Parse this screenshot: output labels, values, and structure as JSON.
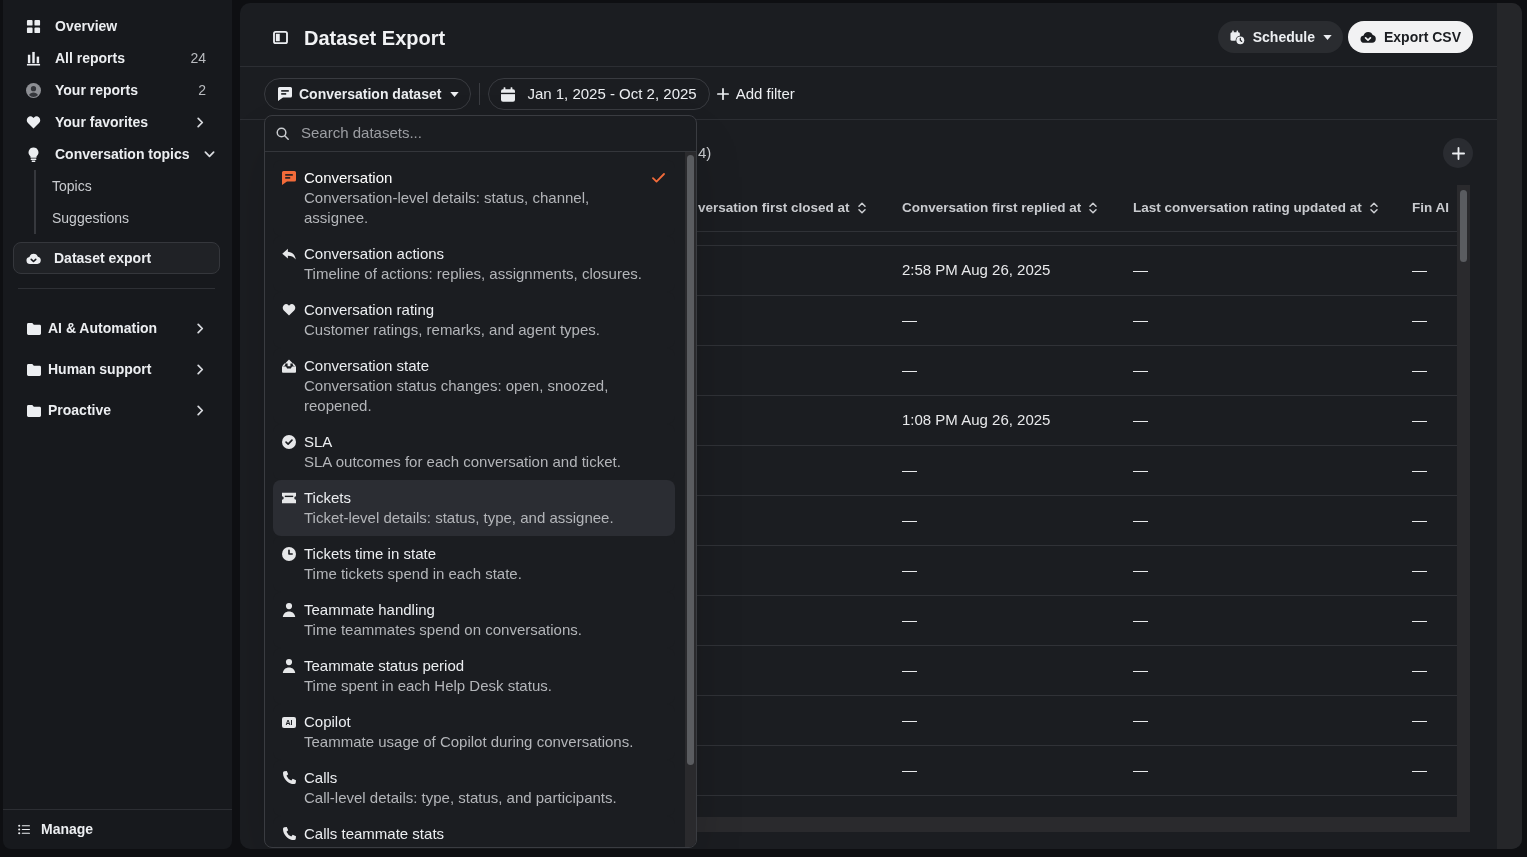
{
  "sidebar": {
    "items": [
      {
        "label": "Overview",
        "selected": false
      },
      {
        "label": "All reports",
        "count": "24",
        "selected": false
      },
      {
        "label": "Your reports",
        "count": "2",
        "selected": false
      },
      {
        "label": "Your favorites",
        "expanded": false,
        "selected": false
      },
      {
        "label": "Conversation topics",
        "expanded": true,
        "selected": false,
        "children": [
          {
            "label": "Topics",
            "selected": false
          },
          {
            "label": "Suggestions",
            "selected": false
          }
        ]
      },
      {
        "label": "Dataset export",
        "selected": true
      }
    ],
    "sections": [
      {
        "label": "AI & Automation",
        "expanded": false
      },
      {
        "label": "Human support",
        "expanded": false
      },
      {
        "label": "Proactive",
        "expanded": false
      }
    ],
    "footer": {
      "label": "Manage"
    }
  },
  "header": {
    "title": "Dataset Export",
    "buttons": [
      {
        "kind": "menu",
        "label": "Schedule"
      },
      {
        "kind": "primary",
        "label": "Export CSV"
      }
    ]
  },
  "filters": {
    "dataset": {
      "label": "Conversation dataset",
      "expanded": true
    },
    "date_range": {
      "label": "Jan 1, 2025 - Oct 2, 2025"
    },
    "add_filter": {
      "label": "Add filter"
    }
  },
  "dataset_menu": {
    "search": {
      "placeholder": "Search datasets..."
    },
    "items": [
      {
        "title": "Conversation",
        "description": "Conversation-level details: status, channel, assignee.",
        "selected": true,
        "highlighted": false
      },
      {
        "title": "Conversation actions",
        "description": "Timeline of actions: replies, assignments, closures.",
        "selected": false,
        "highlighted": false
      },
      {
        "title": "Conversation rating",
        "description": "Customer ratings, remarks, and agent types.",
        "selected": false,
        "highlighted": false
      },
      {
        "title": "Conversation state",
        "description": "Conversation status changes: open, snoozed, reopened.",
        "selected": false,
        "highlighted": false
      },
      {
        "title": "SLA",
        "description": "SLA outcomes for each conversation and ticket.",
        "selected": false,
        "highlighted": false
      },
      {
        "title": "Tickets",
        "description": "Ticket-level details: status, type, and assignee.",
        "selected": false,
        "highlighted": true
      },
      {
        "title": "Tickets time in state",
        "description": "Time tickets spend in each state.",
        "selected": false,
        "highlighted": false
      },
      {
        "title": "Teammate handling",
        "description": "Time teammates spend on conversations.",
        "selected": false,
        "highlighted": false
      },
      {
        "title": "Teammate status period",
        "description": "Time spent in each Help Desk status.",
        "selected": false,
        "highlighted": false
      },
      {
        "title": "Copilot",
        "badge": "AI",
        "description": "Teammate usage of Copilot during conversations.",
        "selected": false,
        "highlighted": false
      },
      {
        "title": "Calls",
        "description": "Call-level details: type, status, and participants.",
        "selected": false,
        "highlighted": false
      },
      {
        "title": "Calls teammate stats",
        "selected": false,
        "highlighted": false
      }
    ]
  },
  "table": {
    "count": "4)",
    "columns": [
      {
        "label": "versation first closed at",
        "sortable": true
      },
      {
        "label": "Conversation first replied at",
        "sortable": true
      },
      {
        "label": "Last conversation rating updated at",
        "sortable": true
      },
      {
        "label": "Fin AI",
        "sortable": false
      }
    ],
    "rows": [
      {
        "first_replied_at": "2:58 PM Aug 26, 2025",
        "rating_updated_at": "—",
        "column_4": "—"
      },
      {
        "first_replied_at": "—",
        "rating_updated_at": "—",
        "column_4": "—"
      },
      {
        "first_replied_at": "—",
        "rating_updated_at": "—",
        "column_4": "—"
      },
      {
        "first_replied_at": "1:08 PM Aug 26, 2025",
        "rating_updated_at": "—",
        "column_4": "—"
      },
      {
        "first_replied_at": "—",
        "rating_updated_at": "—",
        "column_4": "—"
      },
      {
        "first_replied_at": "—",
        "rating_updated_at": "—",
        "column_4": "—"
      },
      {
        "first_replied_at": "—",
        "rating_updated_at": "—",
        "column_4": "—"
      },
      {
        "first_replied_at": "—",
        "rating_updated_at": "—",
        "column_4": "—"
      },
      {
        "first_replied_at": "—",
        "rating_updated_at": "—",
        "column_4": "—"
      },
      {
        "first_replied_at": "—",
        "rating_updated_at": "—",
        "column_4": "—"
      },
      {
        "first_replied_at": "—",
        "rating_updated_at": "—",
        "column_4": "—"
      }
    ]
  }
}
